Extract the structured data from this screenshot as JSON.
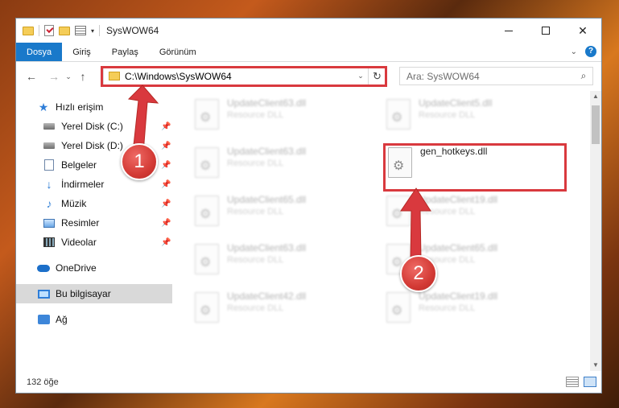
{
  "window": {
    "title": "SysWOW64"
  },
  "ribbon": {
    "tabs": [
      "Dosya",
      "Giriş",
      "Paylaş",
      "Görünüm"
    ],
    "active_tab": "Dosya",
    "help": "?"
  },
  "navigation": {
    "back": "←",
    "forward": "→",
    "recent": "⌄",
    "up": "↑"
  },
  "address": {
    "path": "C:\\Windows\\SysWOW64",
    "refresh": "↻",
    "dropdown": "⌄"
  },
  "search": {
    "placeholder": "Ara: SysWOW64",
    "icon": "search-icon"
  },
  "sidebar": {
    "items": [
      {
        "label": "Hızlı erişim",
        "icon": "star-icon",
        "pinned": false,
        "selected": false
      },
      {
        "label": "Yerel Disk (C:)",
        "icon": "disk-icon",
        "pinned": true,
        "selected": false
      },
      {
        "label": "Yerel Disk (D:)",
        "icon": "disk-icon",
        "pinned": true,
        "selected": false
      },
      {
        "label": "Belgeler",
        "icon": "documents-icon",
        "pinned": true,
        "selected": false
      },
      {
        "label": "İndirmeler",
        "icon": "download-icon",
        "pinned": true,
        "selected": false
      },
      {
        "label": "Müzik",
        "icon": "music-icon",
        "pinned": true,
        "selected": false
      },
      {
        "label": "Resimler",
        "icon": "pictures-icon",
        "pinned": true,
        "selected": false
      },
      {
        "label": "Videolar",
        "icon": "videos-icon",
        "pinned": true,
        "selected": false
      },
      {
        "label": "OneDrive",
        "icon": "onedrive-icon",
        "pinned": false,
        "selected": false
      },
      {
        "label": "Bu bilgisayar",
        "icon": "computer-icon",
        "pinned": false,
        "selected": true
      },
      {
        "label": "Ağ",
        "icon": "network-icon",
        "pinned": false,
        "selected": false
      }
    ]
  },
  "files": [
    {
      "name": "UpdateClient63.dll",
      "type": "Resource DLL",
      "blurred": true
    },
    {
      "name": "UpdateClient5.dll",
      "type": "Resource DLL",
      "blurred": true
    },
    {
      "name": "UpdateClient63.dll",
      "type": "Resource DLL",
      "blurred": true
    },
    {
      "name": "gen_hotkeys.dll",
      "type": "",
      "blurred": false
    },
    {
      "name": "UpdateClient65.dll",
      "type": "Resource DLL",
      "blurred": true
    },
    {
      "name": "UpdateClient19.dll",
      "type": "Resource DLL",
      "blurred": true
    },
    {
      "name": "UpdateClient63.dll",
      "type": "Resource DLL",
      "blurred": true
    },
    {
      "name": "UpdateClient65.dll",
      "type": "Resource DLL",
      "blurred": true
    },
    {
      "name": "UpdateClient42.dll",
      "type": "Resource DLL",
      "blurred": true
    },
    {
      "name": "UpdateClient19.dll",
      "type": "Resource DLL",
      "blurred": true
    }
  ],
  "status": {
    "item_count": "132 öğe"
  },
  "annotations": {
    "step1": "1",
    "step2": "2",
    "color": "#d9393e"
  }
}
